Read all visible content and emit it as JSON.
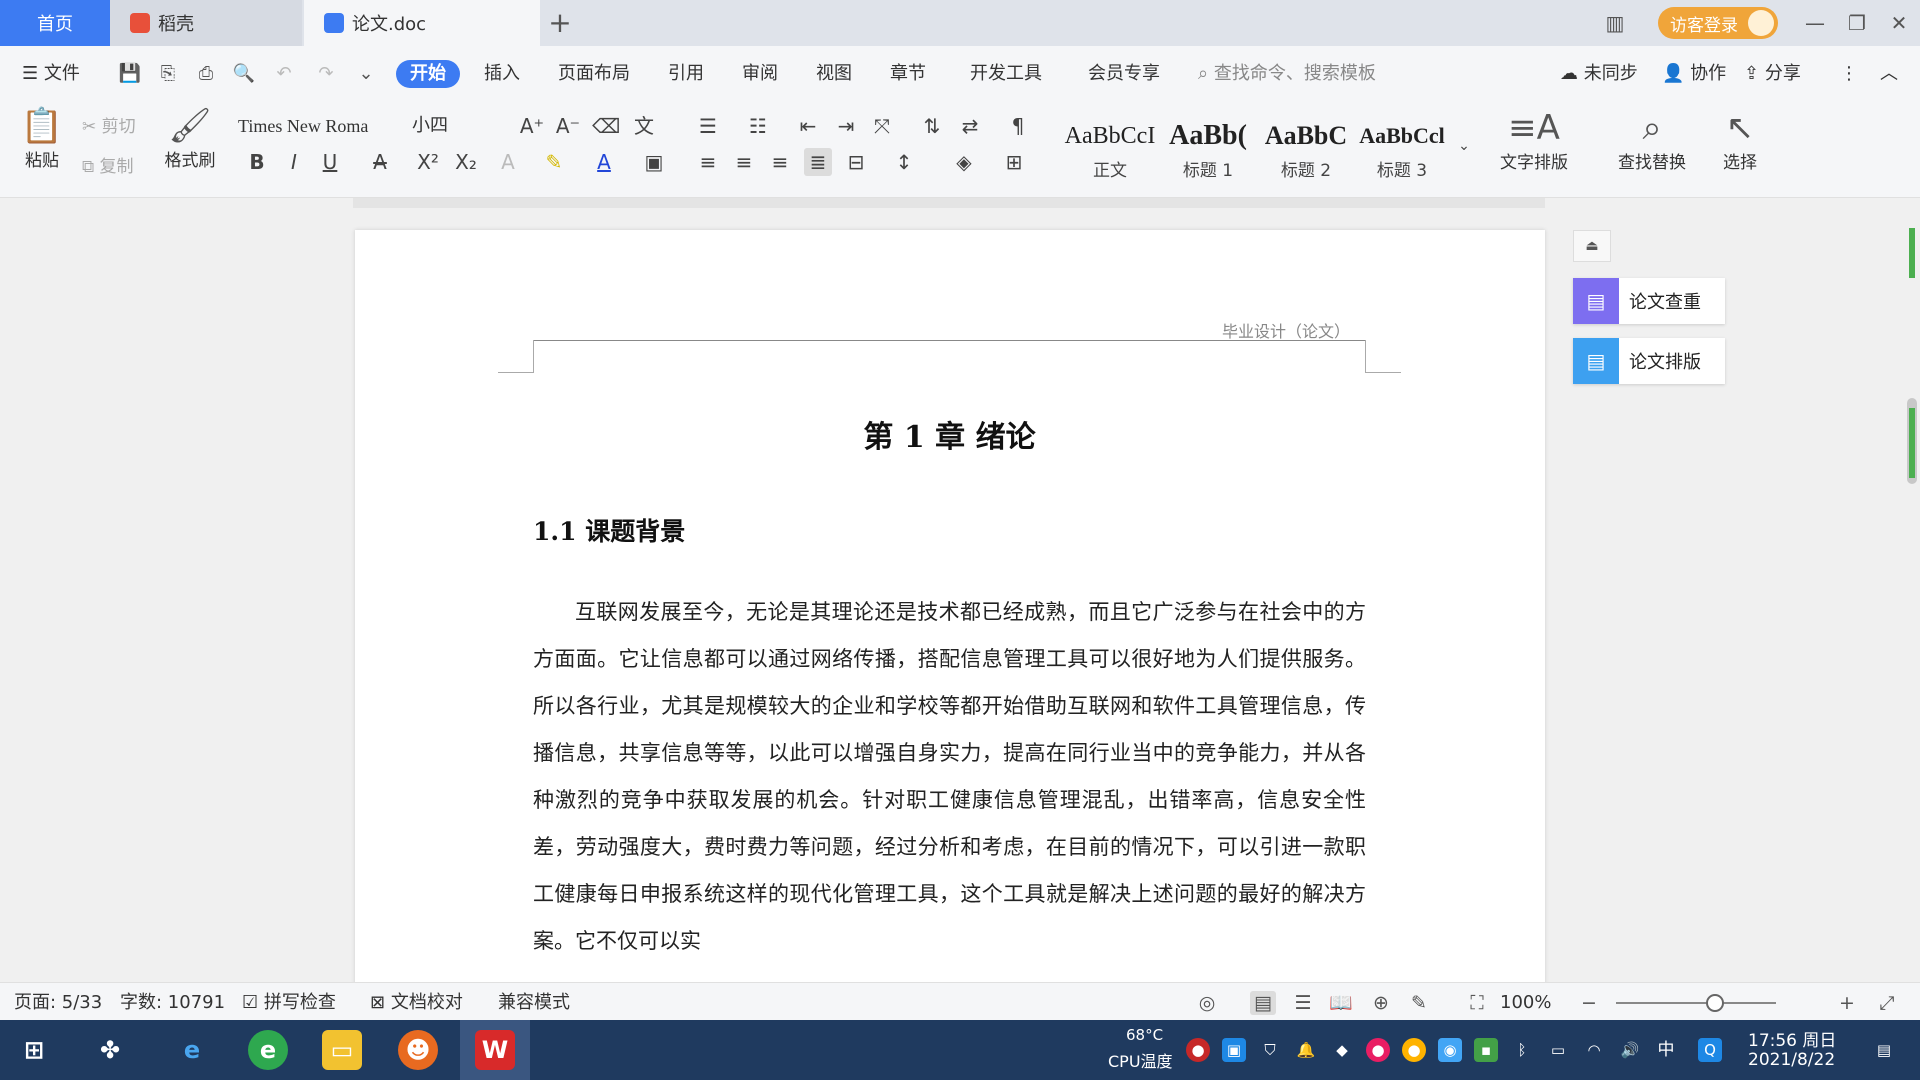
{
  "tabs": {
    "home": "首页",
    "daoke": "稻壳",
    "doc": "论文.doc",
    "add": "+"
  },
  "window": {
    "login": "访客登录",
    "minimize": "—",
    "restore": "❐",
    "close": "✕"
  },
  "menu": {
    "file": "文件",
    "items": [
      "开始",
      "插入",
      "页面布局",
      "引用",
      "审阅",
      "视图",
      "章节",
      "开发工具",
      "会员专享"
    ],
    "search": "查找命令、搜索模板",
    "sync": "未同步",
    "collab": "协作",
    "share": "分享"
  },
  "ribbon": {
    "paste": "粘贴",
    "cut": "剪切",
    "copy": "复制",
    "format_painter": "格式刷",
    "font_name": "Times New Roma",
    "font_size": "小四",
    "styles": [
      {
        "sample": "AaBbCcI",
        "label": "正文"
      },
      {
        "sample": "AaBb(",
        "label": "标题 1"
      },
      {
        "sample": "AaBbC",
        "label": "标题 2"
      },
      {
        "sample": "AaBbCcl",
        "label": "标题 3"
      }
    ],
    "text_layout": "文字排版",
    "find_replace": "查找替换",
    "select": "选择"
  },
  "document": {
    "header": "毕业设计（论文）",
    "chapter_title": "第 1 章  绪论",
    "section_title": "1.1  课题背景",
    "paragraph": "互联网发展至今，无论是其理论还是技术都已经成熟，而且它广泛参与在社会中的方方面面。它让信息都可以通过网络传播，搭配信息管理工具可以很好地为人们提供服务。所以各行业，尤其是规模较大的企业和学校等都开始借助互联网和软件工具管理信息，传播信息，共享信息等等，以此可以增强自身实力，提高在同行业当中的竞争能力，并从各种激烈的竞争中获取发展的机会。针对职工健康信息管理混乱，出错率高，信息安全性差，劳动强度大，费时费力等问题，经过分析和考虑，在目前的情况下，可以引进一款职工健康每日申报系统这样的现代化管理工具，这个工具就是解决上述问题的最好的解决方案。它不仅可以实"
  },
  "side_panel": {
    "check": "论文查重",
    "layout": "论文排版"
  },
  "status": {
    "page": "页面: 5/33",
    "words": "字数: 10791",
    "spell": "拼写检查",
    "proofread": "文档校对",
    "compat": "兼容模式",
    "zoom": "100%",
    "zoom_level": 1.0
  },
  "taskbar": {
    "cpu_temp": "68°C",
    "cpu_label": "CPU温度",
    "ime": "中",
    "time": "17:56 周日",
    "date": "2021/8/22"
  },
  "colors": {
    "accent": "#3d7bf2",
    "login": "#f0a53a",
    "taskbar": "#1f3a5f"
  }
}
